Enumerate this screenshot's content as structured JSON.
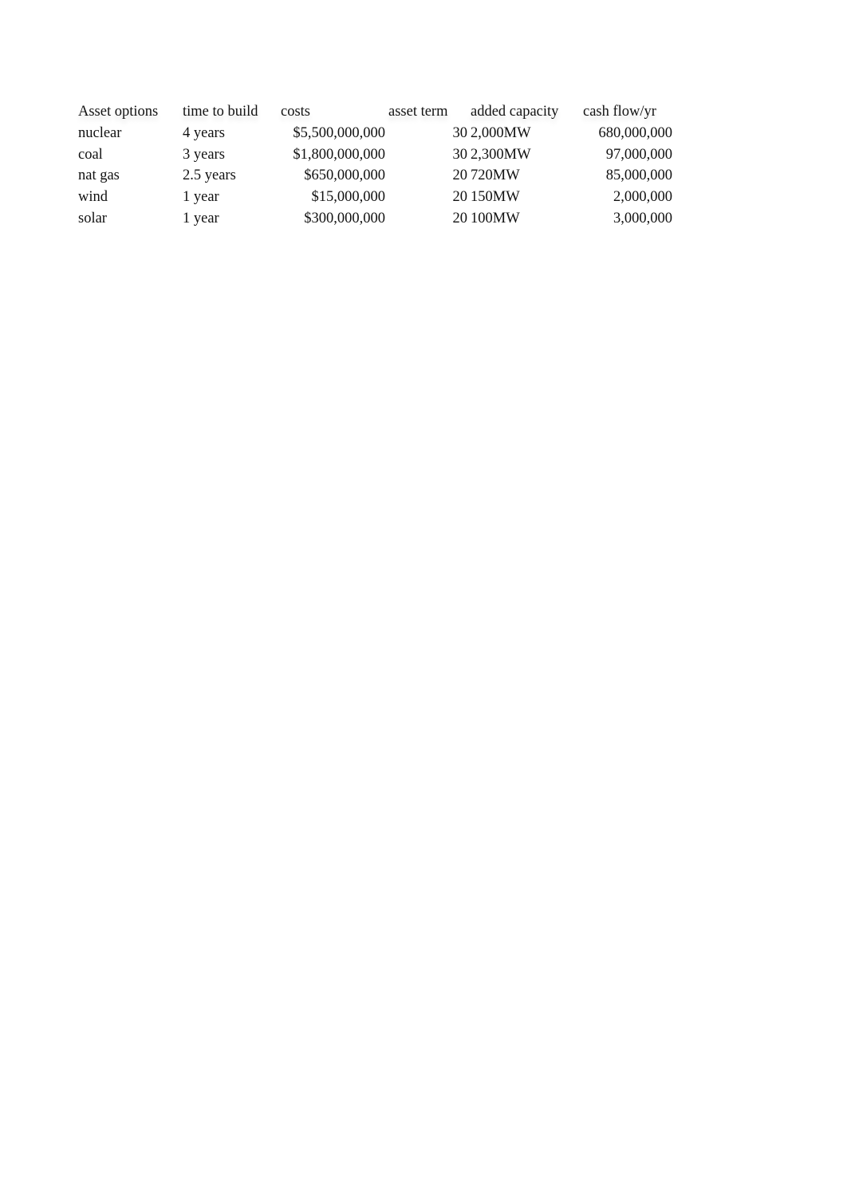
{
  "table": {
    "headers": [
      "Asset options",
      "time to build",
      "costs",
      "asset term",
      "added capacity",
      "cash flow/yr"
    ],
    "rows": [
      {
        "asset": "nuclear",
        "time_to_build": "4 years",
        "costs": "$5,500,000,000",
        "asset_term": "30",
        "added_capacity": "2,000MW",
        "cash_flow_yr": "680,000,000"
      },
      {
        "asset": "coal",
        "time_to_build": "3 years",
        "costs": "$1,800,000,000",
        "asset_term": "30",
        "added_capacity": "2,300MW",
        "cash_flow_yr": "97,000,000"
      },
      {
        "asset": "nat gas",
        "time_to_build": "2.5 years",
        "costs": "$650,000,000",
        "asset_term": "20",
        "added_capacity": "720MW",
        "cash_flow_yr": "85,000,000"
      },
      {
        "asset": "wind",
        "time_to_build": "1 year",
        "costs": "$15,000,000",
        "asset_term": "20",
        "added_capacity": "150MW",
        "cash_flow_yr": "2,000,000"
      },
      {
        "asset": "solar",
        "time_to_build": "1 year",
        "costs": "$300,000,000",
        "asset_term": "20",
        "added_capacity": "100MW",
        "cash_flow_yr": "3,000,000"
      }
    ]
  }
}
